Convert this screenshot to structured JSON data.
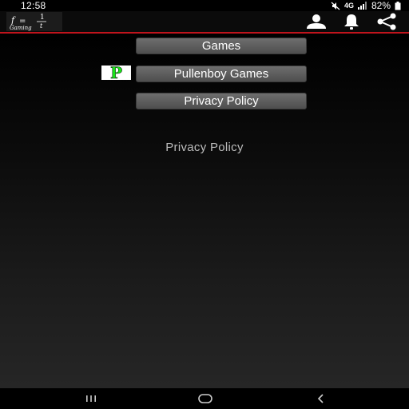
{
  "status_bar": {
    "time": "12:58",
    "battery_text": "82%",
    "network_label": "4G"
  },
  "app_bar": {
    "logo": {
      "f": "f",
      "equals": "=",
      "numerator": "1",
      "denominator": "t",
      "subtitle": "Gaming"
    },
    "accent_color": "#c0141c",
    "actions": [
      "profile-icon",
      "bell-icon",
      "share-icon"
    ]
  },
  "menu": {
    "games_label": "Games",
    "pullenboy_label": "Pullenboy Games",
    "privacy_label": "Privacy Policy",
    "badge_letter": "P",
    "badge_color": "#19e619"
  },
  "content": {
    "privacy_text": "Privacy Policy"
  },
  "nav_bar": {
    "icons": [
      "recent-apps-icon",
      "home-icon",
      "back-icon"
    ]
  }
}
